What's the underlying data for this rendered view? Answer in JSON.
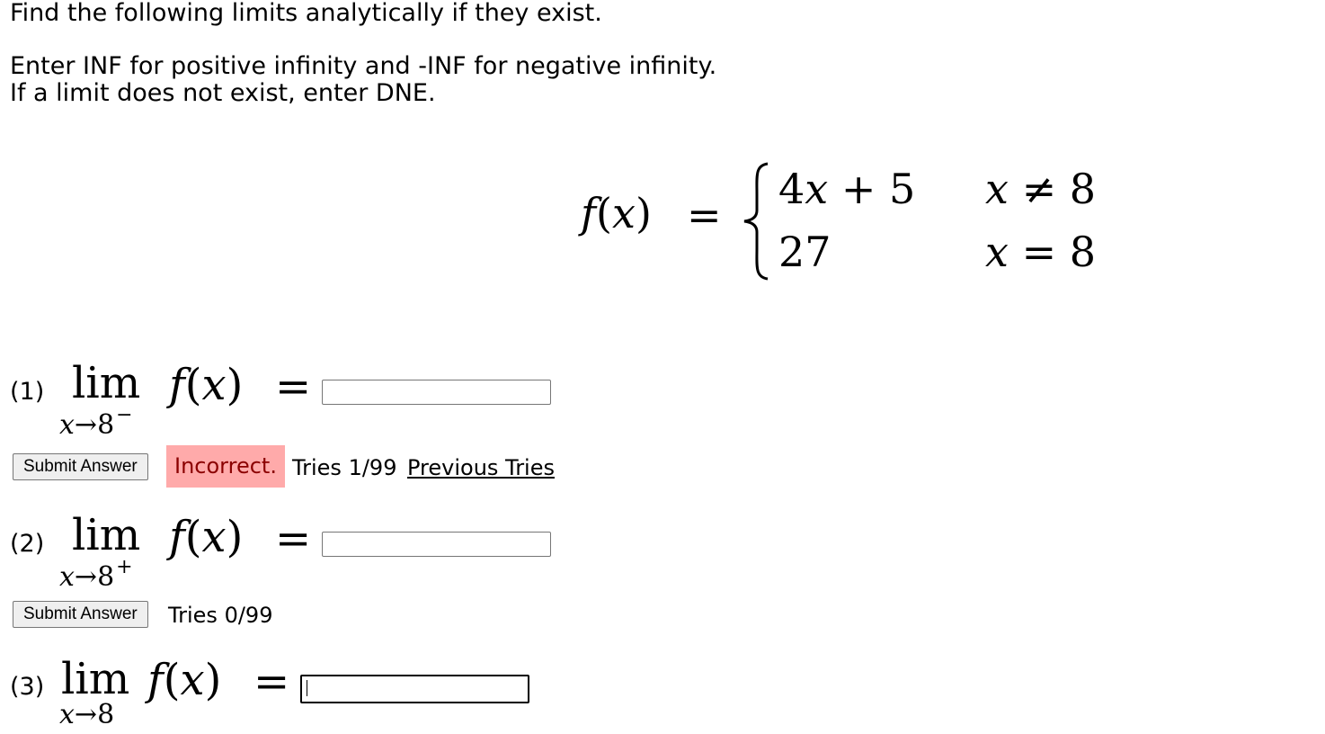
{
  "header": {
    "line1": "Find the following limits analytically if they exist.",
    "line2": "Enter INF for positive infinity and -INF for negative infinity.",
    "line3": "If a limit does not exist, enter DNE."
  },
  "piecewise": {
    "lhs_f": "f",
    "lhs_x": "x",
    "equals": "=",
    "row1_expr_coef": "4",
    "row1_expr_var": "x",
    "row1_expr_rest": " + 5",
    "row1_cond_var": "x",
    "row1_cond_op": "≠",
    "row1_cond_val": "8",
    "row2_expr": "27",
    "row2_cond_var": "x",
    "row2_cond_op": "=",
    "row2_cond_val": "8"
  },
  "parts": [
    {
      "label": "(1)",
      "lim": "lim",
      "sub_var": "x",
      "sub_arrow": "→",
      "sub_val": "8",
      "sub_sup": "−",
      "f": "f",
      "x": "x",
      "eq": "=",
      "answer_value": "",
      "submit_label": "Submit Answer",
      "status": "Incorrect.",
      "tries": "Tries 1/99",
      "previous_tries": "Previous Tries"
    },
    {
      "label": "(2)",
      "lim": "lim",
      "sub_var": "x",
      "sub_arrow": "→",
      "sub_val": "8",
      "sub_sup": "+",
      "f": "f",
      "x": "x",
      "eq": "=",
      "answer_value": "",
      "submit_label": "Submit Answer",
      "tries": "Tries 0/99"
    },
    {
      "label": "(3)",
      "lim": "lim",
      "sub_var": "x",
      "sub_arrow": "→",
      "sub_val": "8",
      "f": "f",
      "x": "x",
      "eq": "=",
      "answer_value": ""
    }
  ],
  "colors": {
    "incorrect_bg": "#ffaaaa",
    "incorrect_text": "#8b0000"
  }
}
